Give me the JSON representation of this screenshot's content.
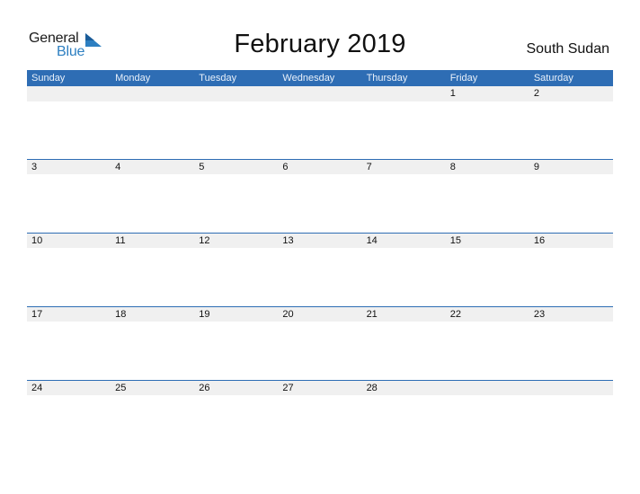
{
  "logo": {
    "general": "General",
    "blue": "Blue",
    "colors": {
      "general": "#1a1a1a",
      "blue": "#2d7fc1"
    }
  },
  "title": "February 2019",
  "country": "South Sudan",
  "colors": {
    "header_bg": "#2e6db4",
    "header_text": "#e8f0fa",
    "date_strip_bg": "#f0f0f0",
    "week_border": "#2e6db4"
  },
  "weekdays": [
    "Sunday",
    "Monday",
    "Tuesday",
    "Wednesday",
    "Thursday",
    "Friday",
    "Saturday"
  ],
  "weeks": [
    [
      "",
      "",
      "",
      "",
      "",
      "1",
      "2"
    ],
    [
      "3",
      "4",
      "5",
      "6",
      "7",
      "8",
      "9"
    ],
    [
      "10",
      "11",
      "12",
      "13",
      "14",
      "15",
      "16"
    ],
    [
      "17",
      "18",
      "19",
      "20",
      "21",
      "22",
      "23"
    ],
    [
      "24",
      "25",
      "26",
      "27",
      "28",
      "",
      ""
    ]
  ]
}
